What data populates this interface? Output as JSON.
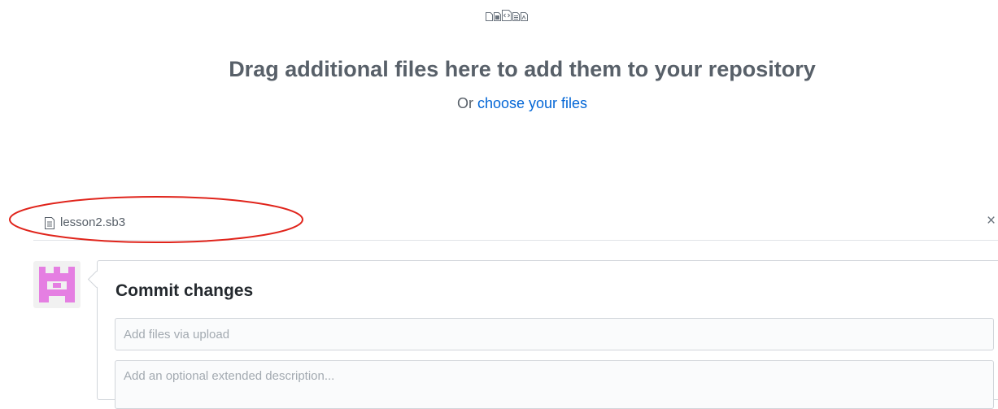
{
  "dropzone": {
    "icons": [
      "file-icon",
      "file-media-icon",
      "file-code-icon",
      "file-text-icon",
      "file-pdf-icon"
    ],
    "title": "Drag additional files here to add them to your repository",
    "subtitle_prefix": "Or ",
    "choose_link": "choose your files"
  },
  "upload": {
    "file_name": "lesson2.sb3",
    "remove_symbol": "×",
    "highlight_color": "#e0241b"
  },
  "commit": {
    "avatar_color": "#e57fe2",
    "title": "Commit changes",
    "summary_placeholder": "Add files via upload",
    "description_placeholder": "Add an optional extended description..."
  }
}
